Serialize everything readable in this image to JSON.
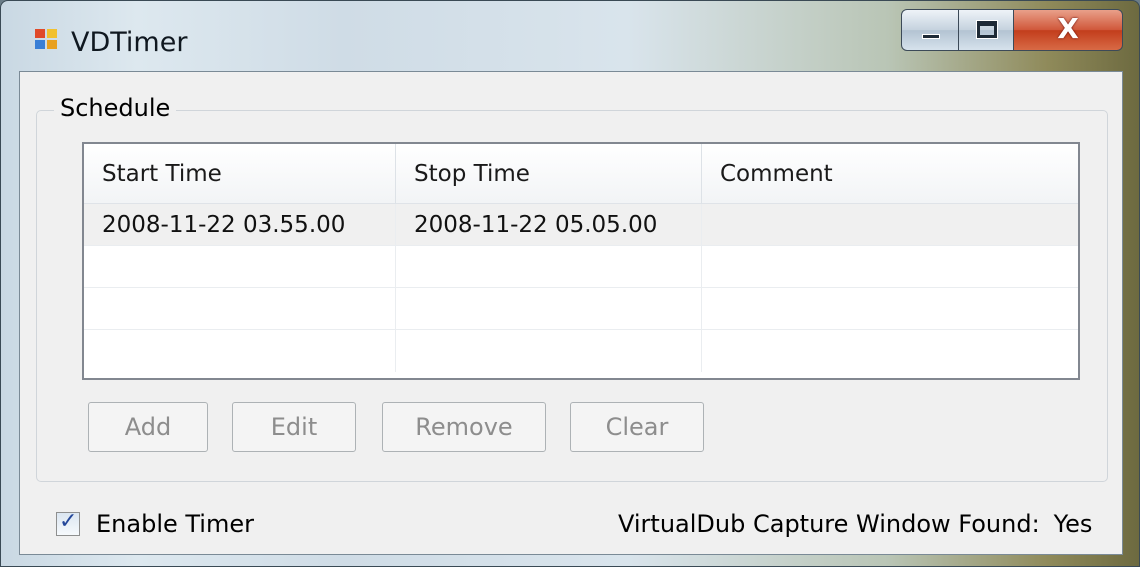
{
  "window": {
    "title": "VDTimer",
    "icon": "app-icon",
    "close_glyph": "X"
  },
  "schedule": {
    "group_label": "Schedule",
    "columns": [
      "Start Time",
      "Stop Time",
      "Comment"
    ],
    "rows": [
      {
        "start": "2008-11-22  03.55.00",
        "stop": "2008-11-22  05.05.00",
        "comment": ""
      },
      {
        "start": "",
        "stop": "",
        "comment": ""
      },
      {
        "start": "",
        "stop": "",
        "comment": ""
      },
      {
        "start": "",
        "stop": "",
        "comment": ""
      }
    ],
    "buttons": {
      "add": "Add",
      "edit": "Edit",
      "remove": "Remove",
      "clear": "Clear"
    }
  },
  "footer": {
    "enable_timer_label": "Enable Timer",
    "enable_timer_checked": true,
    "check_glyph": "✓",
    "status_label": "VirtualDub Capture Window Found:",
    "status_value": "Yes"
  }
}
